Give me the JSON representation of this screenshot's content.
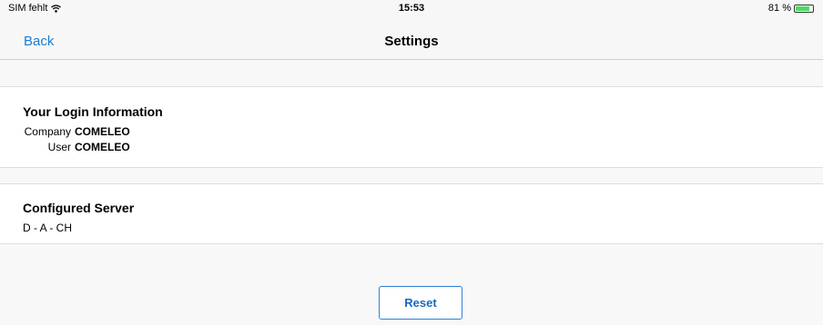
{
  "status_bar": {
    "carrier": "SIM fehlt",
    "wifi_icon": "wifi-icon",
    "time": "15:53",
    "battery_text": "81 %",
    "battery_level": 0.81,
    "battery_color": "#4cd964"
  },
  "nav": {
    "back_label": "Back",
    "title": "Settings",
    "accent": "#1a7dd7"
  },
  "login_info": {
    "title": "Your Login Information",
    "company_label": "Company",
    "company_value": "COMELEO",
    "user_label": "User",
    "user_value": "COMELEO"
  },
  "server": {
    "title": "Configured Server",
    "value": "D - A - CH"
  },
  "actions": {
    "reset_label": "Reset"
  }
}
